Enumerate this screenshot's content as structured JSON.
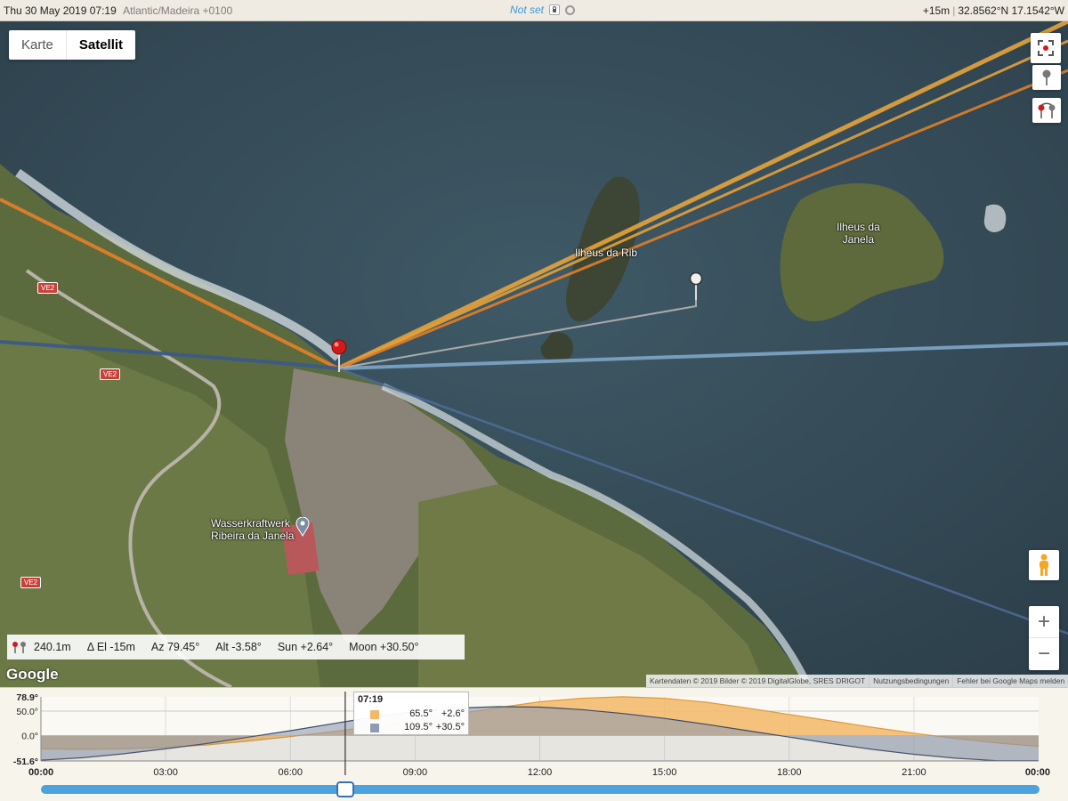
{
  "topbar": {
    "datetime": "Thu 30 May 2019 07:19",
    "timezone": "Atlantic/Madeira +0100",
    "status": "Not set",
    "elevation": "+15m",
    "coordinates": "32.8562°N 17.1542°W"
  },
  "map": {
    "type_buttons": [
      "Karte",
      "Satellit"
    ],
    "places": {
      "islet_west": "Ilheus da Rib",
      "islet_east": [
        "Ilheus da",
        "Janela"
      ],
      "power_station": [
        "Wasserkraftwerk",
        "Ribeira da Janela"
      ]
    },
    "roads": [
      "VE2",
      "VE2",
      "VE2"
    ],
    "google_logo": "Google",
    "attribution": [
      "Kartendaten © 2019 Bilder © 2019 DigitalGlobe, SRES DRIGOT",
      "Nutzungsbedingungen",
      "Fehler bei Google Maps melden"
    ],
    "zoom_in": "+",
    "zoom_out": "−",
    "icons": {
      "fullscreen": "fullscreen-icon",
      "pin": "pin-icon",
      "pins": "pin-pair-icon",
      "pegman": "pegman-icon"
    },
    "colors": {
      "sunrise_line": "#e39a2c",
      "sunset_line": "#e07f28",
      "moon_line": "#3c5a88",
      "moonset_line": "#7fa6c8",
      "current_sun_line": "#f0a83a",
      "geodetic_line": "#aaaaaa"
    }
  },
  "info": {
    "distance": "240.1m",
    "delta_el": "Δ El  -15m",
    "azimuth": "Az 79.45°",
    "altitude": "Alt  -3.58°",
    "sun": "Sun +2.64°",
    "moon": "Moon +30.50°"
  },
  "chart_data": {
    "type": "area",
    "ylim": [
      -51.6,
      78.9
    ],
    "y_ticks": [
      "78.9°",
      "50.0°",
      "0.0°",
      "-51.6°"
    ],
    "x_ticks": [
      "00:00",
      "03:00",
      "06:00",
      "09:00",
      "12:00",
      "15:00",
      "18:00",
      "21:00",
      "00:00"
    ],
    "x_hours": [
      0,
      3,
      6,
      9,
      12,
      15,
      18,
      21,
      24
    ],
    "series": [
      {
        "color": "#f2b866",
        "x": [
          0,
          1,
          2,
          3,
          4,
          5,
          6,
          7,
          8,
          9,
          10,
          11,
          12,
          13,
          14,
          15,
          16,
          17,
          18,
          19,
          20,
          21,
          22,
          23,
          24
        ],
        "values": [
          -27,
          -28,
          -27,
          -24,
          -19,
          -11,
          -2,
          8,
          19,
          31,
          44,
          57,
          69,
          76,
          79,
          76,
          68,
          56,
          43,
          30,
          17,
          5,
          -6,
          -15,
          -22
        ]
      },
      {
        "color": "#8f9bb3",
        "x": [
          0,
          1,
          2,
          3,
          4,
          5,
          6,
          7,
          8,
          9,
          10,
          11,
          12,
          13,
          14,
          15,
          16,
          17,
          18,
          19,
          20,
          21,
          22,
          23,
          24
        ],
        "values": [
          -50,
          -45,
          -37,
          -27,
          -16,
          -3,
          10,
          24,
          38,
          49,
          56,
          59,
          58,
          53,
          45,
          35,
          23,
          10,
          -3,
          -16,
          -28,
          -38,
          -46,
          -51,
          -51
        ]
      }
    ],
    "cursor_time": 7.32,
    "tooltip": {
      "time": "07:19",
      "rows": [
        {
          "color": "#f2b866",
          "azimuth": "65.5°",
          "elevation": "+2.6°"
        },
        {
          "color": "#8f9bb3",
          "azimuth": "109.5°",
          "elevation": "+30.5°"
        }
      ]
    },
    "slider_value": 0.305
  }
}
